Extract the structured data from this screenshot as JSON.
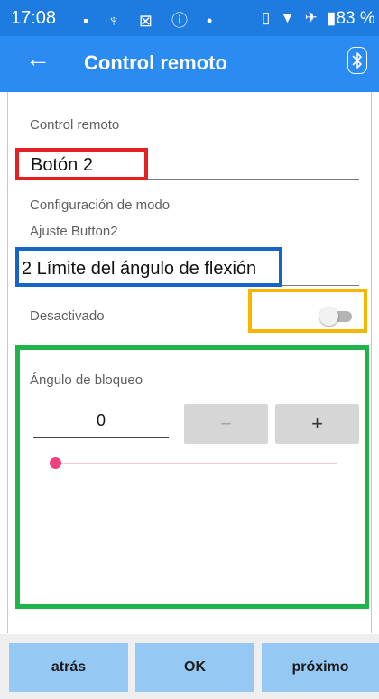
{
  "status_bar": {
    "time": "17:08",
    "left_icons": "▪ ♆ ⊠ ⓘ •",
    "right_icons": "▯ ▼ ✈",
    "battery": "▮83 %"
  },
  "app_bar": {
    "back_icon": "←",
    "title": "Control remoto",
    "bt_icon": "ᛒ"
  },
  "form": {
    "remote_label": "Control remoto",
    "remote_value": "Botón 2",
    "mode_label": "Configuración de modo",
    "adjust_label": "Ajuste Button2",
    "mode_value": "2 Límite del ángulo de flexión",
    "toggle_label": "Desactivado",
    "toggle_on": false
  },
  "lock_angle": {
    "label": "Ángulo de bloqueo",
    "value": "0",
    "minus_label": "−",
    "plus_label": "+",
    "slider_fraction": 0
  },
  "nav": {
    "back_label": "atrás",
    "ok_label": "OK",
    "next_label": "próximo"
  },
  "colors": {
    "status_bar": "#1e7be0",
    "app_bar": "#2a8bf2",
    "nav_button": "#96c8f4",
    "slider_accent": "#f0417a",
    "highlight_red": "#e52020",
    "highlight_blue": "#1565c8",
    "highlight_yellow": "#f6b600",
    "highlight_green": "#1fb54a"
  }
}
